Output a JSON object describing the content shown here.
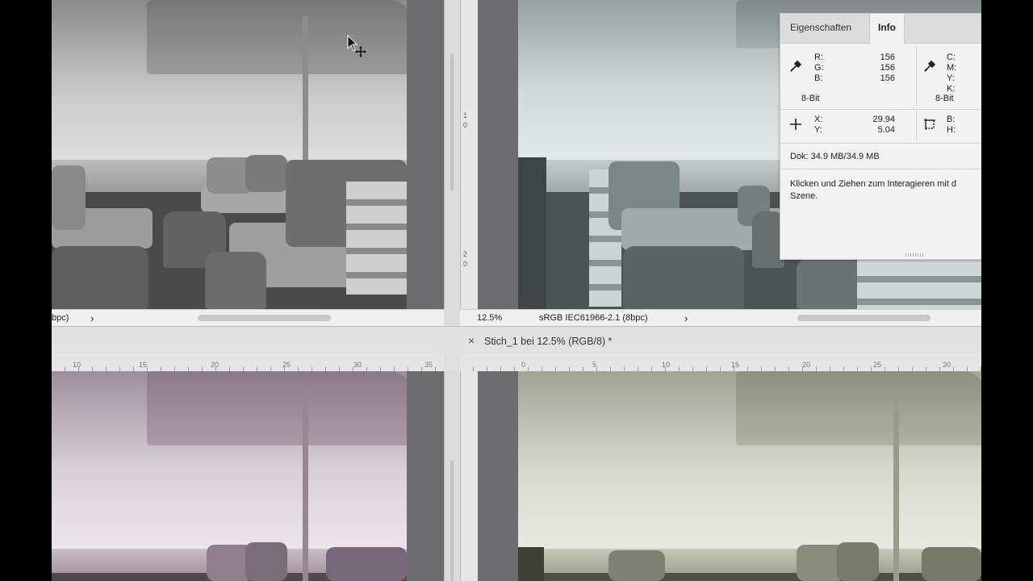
{
  "status_top_left": {
    "profile_text": "bpc)",
    "arrow": "›"
  },
  "status_top_right": {
    "zoom": "12.5%",
    "profile_text": "sRGB IEC61966-2.1 (8bpc)",
    "arrow": "›"
  },
  "document_tab": {
    "close_symbol": "×",
    "title": "Stich_1 bei 12.5% (RGB/8) *"
  },
  "ruler_left_ticks": [
    "10",
    "15",
    "20",
    "25",
    "30",
    "35"
  ],
  "ruler_right_ticks": [
    "0",
    "5",
    "10",
    "15",
    "20",
    "25",
    "30"
  ],
  "ruler_vertical_ticks": [
    "1",
    "0",
    "2",
    "0"
  ],
  "info_panel": {
    "tabs": [
      "Eigenschaften",
      "Info"
    ],
    "active_tab": "Info",
    "rgb": {
      "labels": [
        "R:",
        "G:",
        "B:"
      ],
      "values": [
        "156",
        "156",
        "156"
      ],
      "bit_depth": "8-Bit"
    },
    "cmyk": {
      "labels": [
        "C:",
        "M:",
        "Y:",
        "K:"
      ],
      "bit_depth": "8-Bit"
    },
    "position": {
      "labels": [
        "X:",
        "Y:"
      ],
      "values": [
        "29.94",
        "5.04"
      ]
    },
    "size": {
      "labels": [
        "B:",
        "H:"
      ]
    },
    "doc_size": "Dok: 34.9 MB/34.9 MB",
    "hint": "Klicken und Ziehen zum Interagieren mit d Szene."
  },
  "tint_colors": {
    "top_left": "#8d8d8d",
    "top_right": "#8f9c9c",
    "bottom_left": "#9c8f99",
    "bottom_right": "#a3a596"
  }
}
